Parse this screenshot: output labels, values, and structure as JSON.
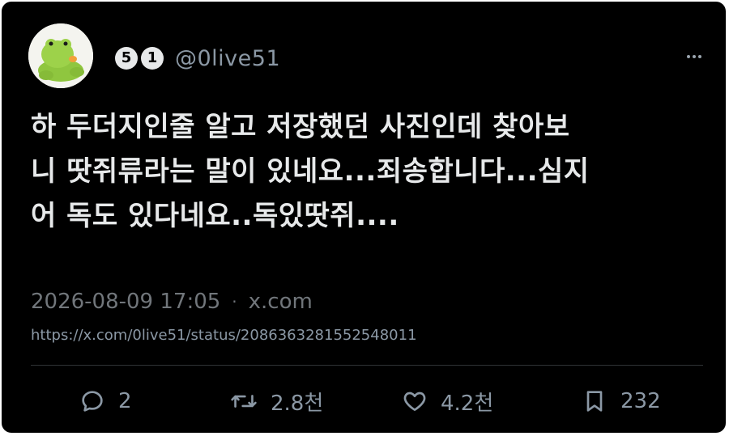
{
  "author": {
    "badges": [
      "5",
      "1"
    ],
    "handle": "@0live51",
    "avatar_icon": "green-frog-plush-avatar"
  },
  "more_icon": "more-dots-icon",
  "tweet": {
    "text": "하 두더지인줄 알고 저장했던 사진인데 찾아보\n니 땃쥐류라는 말이 있네요...죄송합니다...심지\n어 독도 있다네요..독있땃쥐....",
    "timestamp": "2026-08-09 17:05",
    "separator": "·",
    "source": "x.com",
    "url": "https://x.com/0live51/status/2086363281552548011"
  },
  "actions": {
    "reply": {
      "icon": "reply-icon",
      "count": "2"
    },
    "retweet": {
      "icon": "retweet-icon",
      "count": "2.8천"
    },
    "like": {
      "icon": "heart-icon",
      "count": "4.2천"
    },
    "bookmark": {
      "icon": "bookmark-icon",
      "count": "232"
    }
  },
  "colors": {
    "background": "#000000",
    "text": "#e7e9ea",
    "muted": "#71767b",
    "icon": "#8b98a5"
  }
}
